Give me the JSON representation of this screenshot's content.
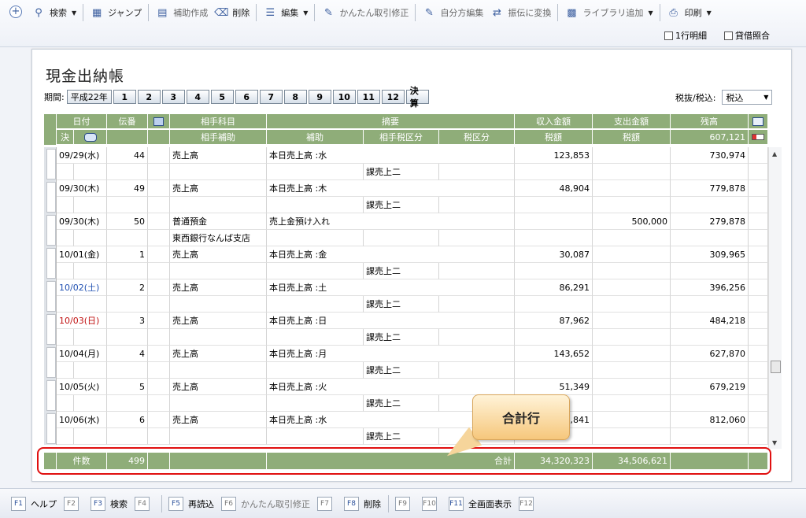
{
  "toolbar": {
    "search": "検索",
    "jump": "ジャンプ",
    "sub_create": "補助作成",
    "delete": "削除",
    "edit": "編集",
    "easy_fix": "かんたん取引修正",
    "self_edit": "自分方編集",
    "to_transfer": "振伝に変換",
    "library_add": "ライブラリ追加",
    "print": "印刷",
    "one_line": "1行明細",
    "balance_ref": "貸借照合"
  },
  "page": {
    "title": "現金出納帳",
    "period_label": "期間:",
    "era": "平成22年",
    "months": [
      "1",
      "2",
      "3",
      "4",
      "5",
      "6",
      "7",
      "8",
      "9",
      "10",
      "11",
      "12"
    ],
    "settle": "決算",
    "tax_label": "税抜/税込:",
    "tax_value": "税込"
  },
  "header": {
    "date": "日付",
    "voucher": "伝番",
    "account": "相手科目",
    "summary": "摘要",
    "income": "収入金額",
    "expense": "支出金額",
    "balance": "残高",
    "settle": "決",
    "sub": "相手補助",
    "sub2": "補助",
    "tax_cat": "相手税区分",
    "tax_cat2": "税区分",
    "tax1": "税額",
    "tax2": "税額",
    "opening": "607,121"
  },
  "rows": [
    {
      "date": "09/29(水)",
      "no": "44",
      "account": "売上高",
      "summary": "本日売上高 :水",
      "income": "123,853",
      "expense": "",
      "balance": "730,974",
      "sub": "",
      "tax": "課売上二",
      "cls": ""
    },
    {
      "date": "09/30(木)",
      "no": "49",
      "account": "売上高",
      "summary": "本日売上高 :木",
      "income": "48,904",
      "expense": "",
      "balance": "779,878",
      "sub": "",
      "tax": "課売上二",
      "cls": ""
    },
    {
      "date": "09/30(木)",
      "no": "50",
      "account": "普通預金",
      "summary": "売上金預け入れ",
      "income": "",
      "expense": "500,000",
      "balance": "279,878",
      "sub": "東西銀行なんば支店",
      "tax": "",
      "cls": ""
    },
    {
      "date": "10/01(金)",
      "no": "1",
      "account": "売上高",
      "summary": "本日売上高 :金",
      "income": "30,087",
      "expense": "",
      "balance": "309,965",
      "sub": "",
      "tax": "課売上二",
      "cls": ""
    },
    {
      "date": "10/02(土)",
      "no": "2",
      "account": "売上高",
      "summary": "本日売上高 :土",
      "income": "86,291",
      "expense": "",
      "balance": "396,256",
      "sub": "",
      "tax": "課売上二",
      "cls": "blue"
    },
    {
      "date": "10/03(日)",
      "no": "3",
      "account": "売上高",
      "summary": "本日売上高 :日",
      "income": "87,962",
      "expense": "",
      "balance": "484,218",
      "sub": "",
      "tax": "課売上二",
      "cls": "red"
    },
    {
      "date": "10/04(月)",
      "no": "4",
      "account": "売上高",
      "summary": "本日売上高 :月",
      "income": "143,652",
      "expense": "",
      "balance": "627,870",
      "sub": "",
      "tax": "課売上二",
      "cls": ""
    },
    {
      "date": "10/05(火)",
      "no": "5",
      "account": "売上高",
      "summary": "本日売上高 :火",
      "income": "51,349",
      "expense": "",
      "balance": "679,219",
      "sub": "",
      "tax": "課売上二",
      "cls": ""
    },
    {
      "date": "10/06(水)",
      "no": "6",
      "account": "売上高",
      "summary": "本日売上高 :水",
      "income": "32,841",
      "expense": "",
      "balance": "812,060",
      "sub": "",
      "tax": "課売上二",
      "cls": ""
    }
  ],
  "totals": {
    "count_label": "件数",
    "count": "499",
    "total_label": "合計",
    "income": "34,320,323",
    "expense": "34,506,621"
  },
  "callout": "合計行",
  "fkeys": [
    {
      "key": "F1",
      "label": "ヘルプ",
      "on": true
    },
    {
      "key": "F2",
      "label": "",
      "on": false
    },
    {
      "key": "F3",
      "label": "検索",
      "on": true
    },
    {
      "key": "F4",
      "label": "",
      "on": false
    },
    {
      "key": "F5",
      "label": "再読込",
      "on": true
    },
    {
      "key": "F6",
      "label": "かんたん取引修正",
      "on": false
    },
    {
      "key": "F7",
      "label": "",
      "on": false
    },
    {
      "key": "F8",
      "label": "削除",
      "on": true
    },
    {
      "key": "F9",
      "label": "",
      "on": false
    },
    {
      "key": "F10",
      "label": "",
      "on": false
    },
    {
      "key": "F11",
      "label": "全画面表示",
      "on": true
    },
    {
      "key": "F12",
      "label": "",
      "on": false
    }
  ]
}
